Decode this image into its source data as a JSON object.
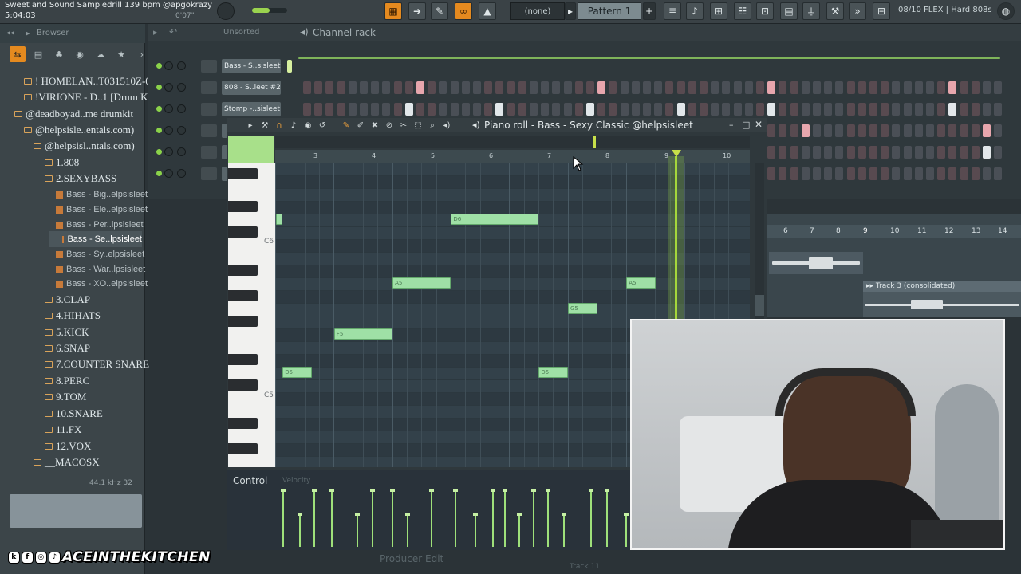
{
  "topbar": {
    "song_title": "Sweet and Sound Sampledrill 139 bpm @apgokrazy",
    "time": "5:04:03",
    "small_time": "0'07\"",
    "none_label": "(none)",
    "pattern_label": "Pattern 1",
    "flex_label": "08/10 FLEX | Hard 808s",
    "master_volume": 0.5
  },
  "browser": {
    "title": "Browser",
    "tree": [
      {
        "label": "! HOMELAN..T031510Z-001",
        "kind": "folder"
      },
      {
        "label": "!VIRIONE - D..1 [Drum Kit]",
        "kind": "folder"
      },
      {
        "label": "@deadboyad..me drumkit",
        "kind": "folder"
      },
      {
        "label": "@helpsisle..entals.com)",
        "kind": "folder"
      },
      {
        "label": "@helpsisl..ntals.com)",
        "kind": "folder"
      },
      {
        "label": "1.808",
        "kind": "folder"
      },
      {
        "label": "2.SEXYBASS",
        "kind": "folder"
      },
      {
        "label": "Bass - Big..elpsisleet",
        "kind": "file"
      },
      {
        "label": "Bass - Ele..elpsisleet",
        "kind": "file"
      },
      {
        "label": "Bass - Per..lpsisleet",
        "kind": "file"
      },
      {
        "label": "Bass - Se..lpsisleet",
        "kind": "file"
      },
      {
        "label": "Bass - Sy..elpsisleet",
        "kind": "file"
      },
      {
        "label": "Bass - War..lpsisleet",
        "kind": "file"
      },
      {
        "label": "Bass - XO..elpsisleet",
        "kind": "file"
      },
      {
        "label": "3.CLAP",
        "kind": "folder"
      },
      {
        "label": "4.HIHATS",
        "kind": "folder"
      },
      {
        "label": "5.KICK",
        "kind": "folder"
      },
      {
        "label": "6.SNAP",
        "kind": "folder"
      },
      {
        "label": "7.COUNTER SNARE",
        "kind": "folder"
      },
      {
        "label": "8.PERC",
        "kind": "folder"
      },
      {
        "label": "9.TOM",
        "kind": "folder"
      },
      {
        "label": "10.SNARE",
        "kind": "folder"
      },
      {
        "label": "11.FX",
        "kind": "folder"
      },
      {
        "label": "12.VOX",
        "kind": "folder"
      },
      {
        "label": "__MACOSX",
        "kind": "folder"
      }
    ],
    "info": "44.1 kHz 32"
  },
  "channel_rack": {
    "unsorted": "Unsorted",
    "title": "Channel rack",
    "channels": [
      {
        "name": "Bass - S..sisleet"
      },
      {
        "name": "808 - S..leet #2"
      },
      {
        "name": "Stomp -..sisleet"
      },
      {
        "name": ""
      },
      {
        "name": ""
      },
      {
        "name": ""
      }
    ]
  },
  "piano_roll": {
    "title": "Piano roll - Bass - Sexy Classic @helpsisleet",
    "ruler": [
      "3",
      "4",
      "5",
      "6",
      "7",
      "8",
      "9",
      "10"
    ],
    "key_labels": [
      "C6",
      "C5"
    ],
    "notes": [
      {
        "label": "",
        "bar": 2.0,
        "len": 0.12,
        "row": 0
      },
      {
        "label": "D6",
        "bar": 5.0,
        "len": 1.5,
        "row": 0
      },
      {
        "label": "A5",
        "bar": 4.0,
        "len": 1.0,
        "row": 5
      },
      {
        "label": "A5",
        "bar": 8.0,
        "len": 0.5,
        "row": 5
      },
      {
        "label": "G5",
        "bar": 7.0,
        "len": 0.5,
        "row": 7
      },
      {
        "label": "F5",
        "bar": 3.0,
        "len": 1.0,
        "row": 9
      },
      {
        "label": "D5",
        "bar": 2.12,
        "len": 0.5,
        "row": 12
      },
      {
        "label": "D5",
        "bar": 6.5,
        "len": 0.5,
        "row": 12
      }
    ],
    "control_label": "Control",
    "velocity_label": "Velocity"
  },
  "playlist": {
    "ruler": [
      "6",
      "7",
      "8",
      "9",
      "10",
      "11",
      "12",
      "13",
      "14"
    ],
    "clip_label": "Track 3 (consolidated)",
    "track_label": "Track 11"
  },
  "overlay": {
    "watermark": "ACEINTHEKITCHEN",
    "producer_edit": "Producer Edit"
  },
  "colors": {
    "accent": "#e58a1f",
    "note": "#9fe0a6",
    "playhead": "#a5d73b",
    "step_pink": "#e7a6ad",
    "step_white": "#e2e7ea"
  }
}
